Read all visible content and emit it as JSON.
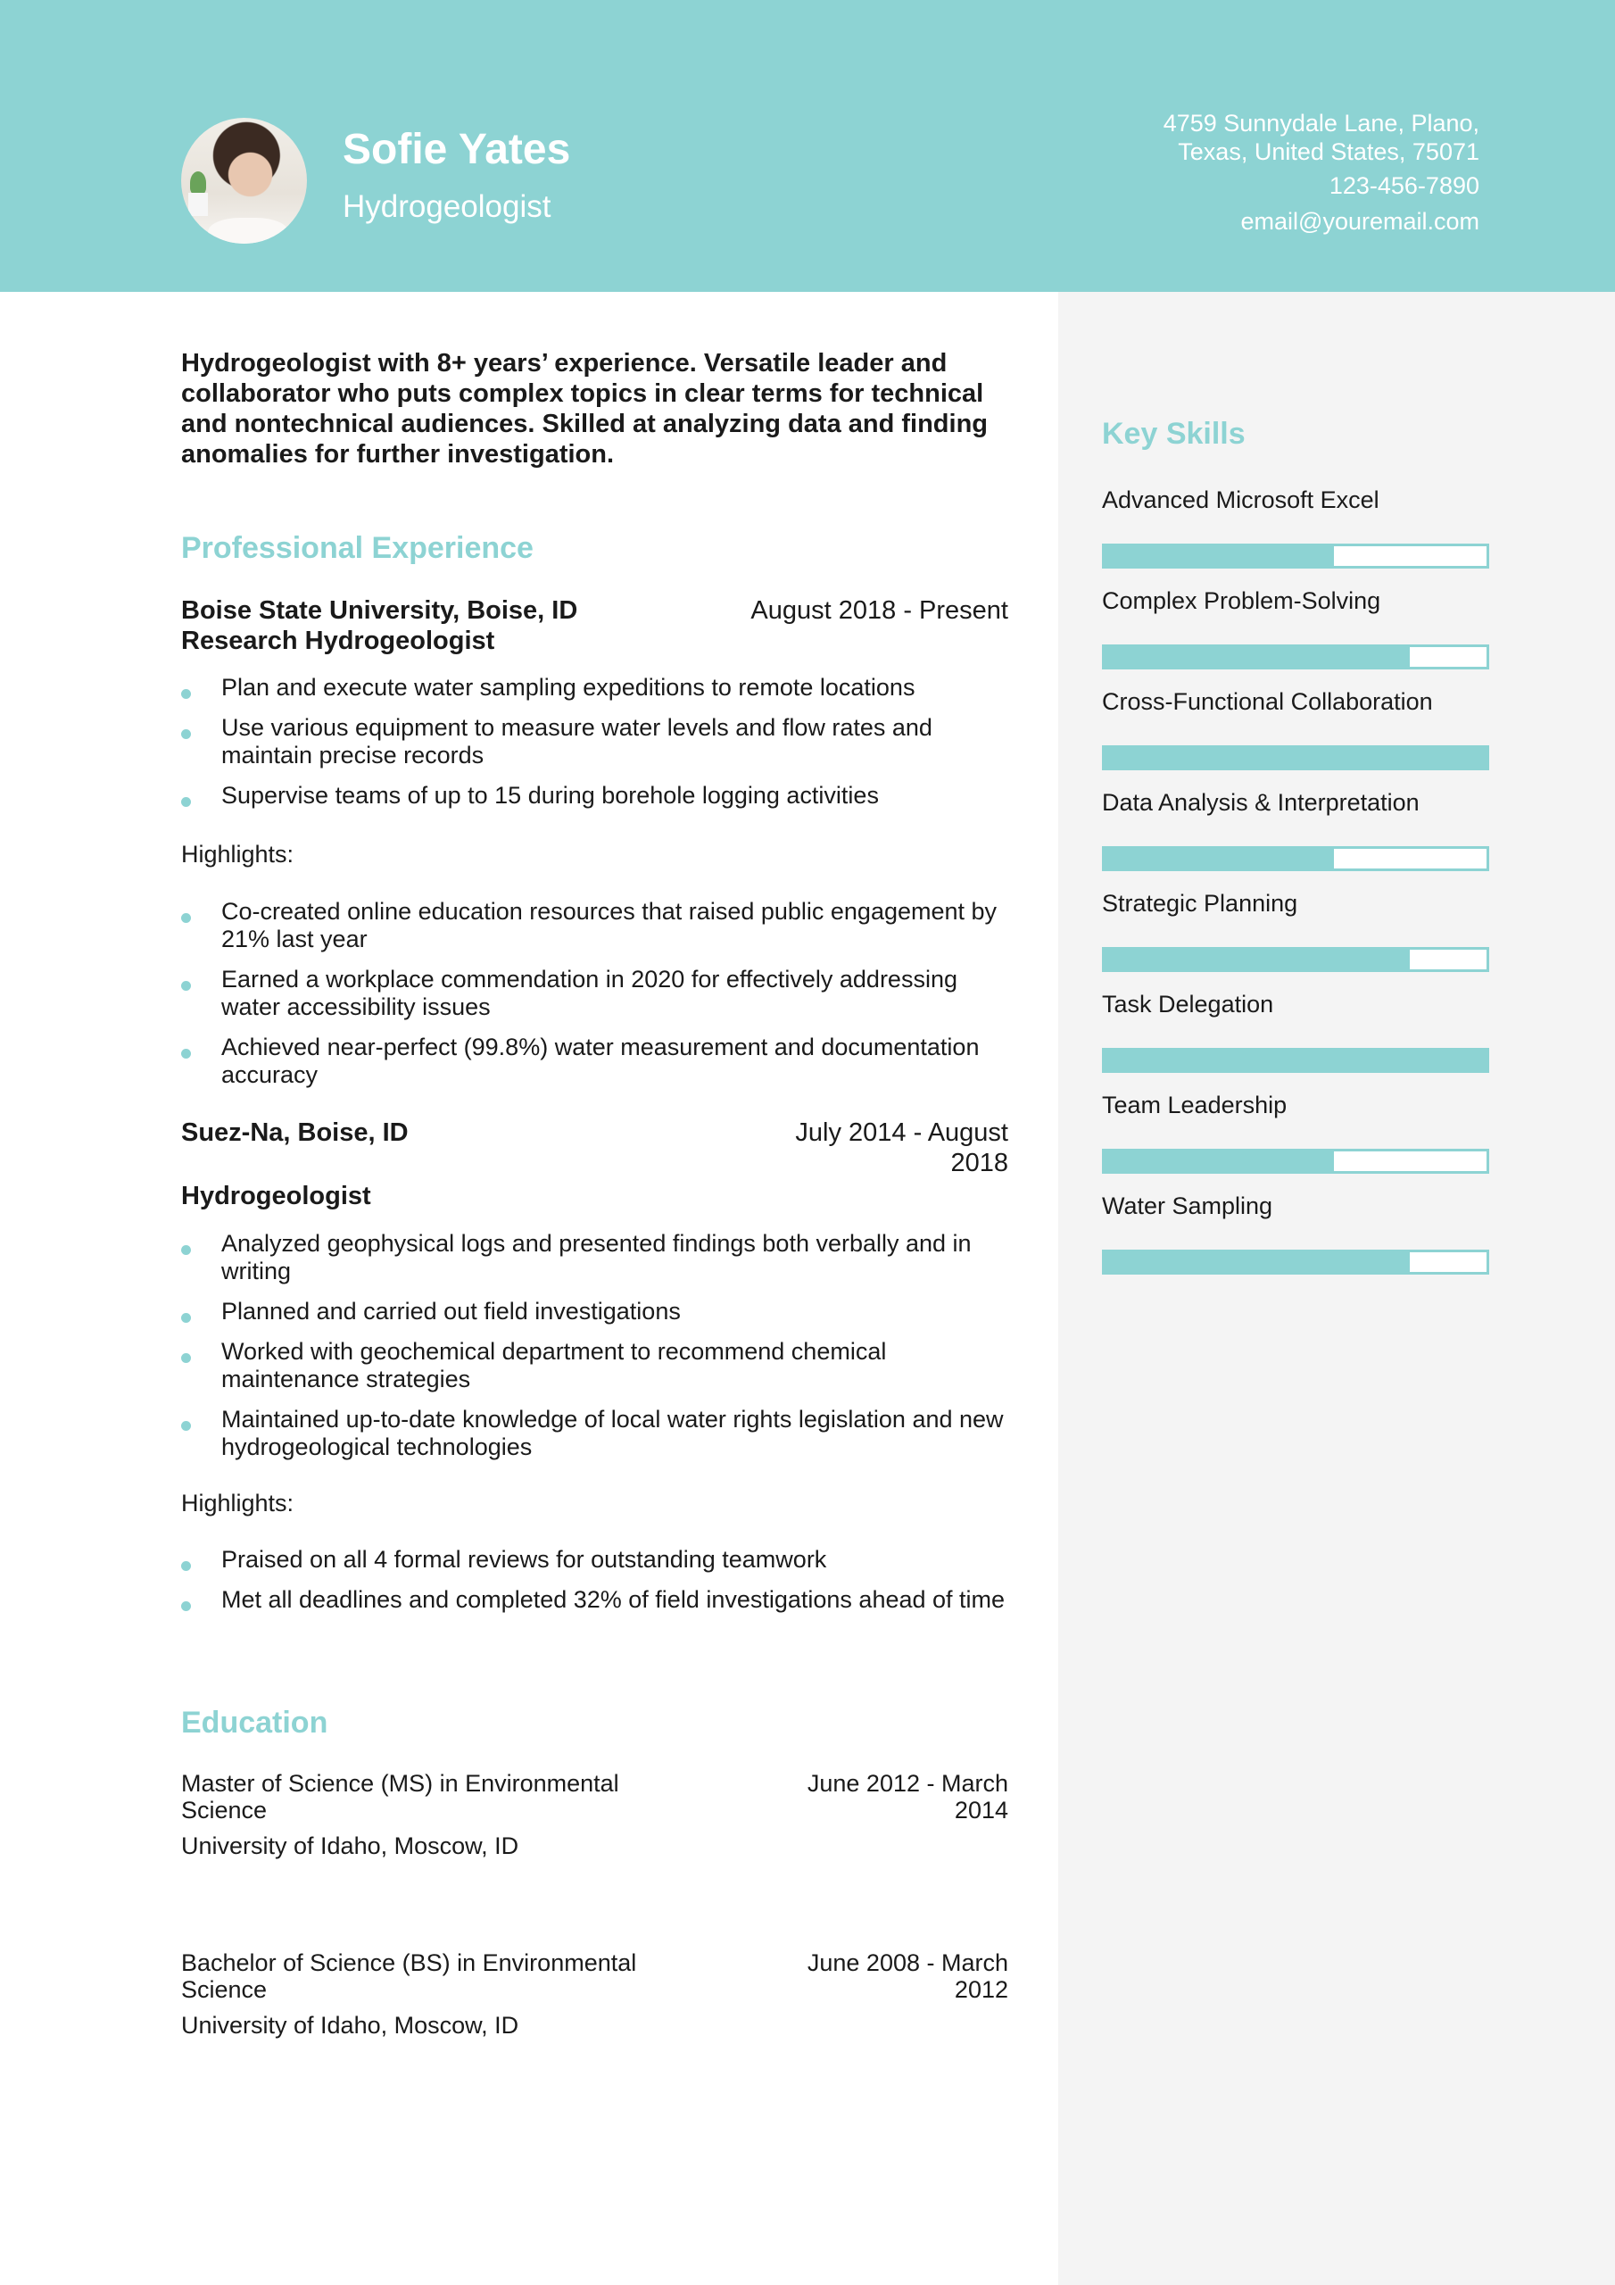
{
  "header": {
    "name": "Sofie Yates",
    "title": "Hydrogeologist",
    "address_line1": "4759 Sunnydale Lane, Plano,",
    "address_line2": "Texas, United States, 75071",
    "phone": "123-456-7890",
    "email": "email@youremail.com"
  },
  "colors": {
    "accent": "#8dd3d3",
    "sidebar_bg": "#f4f4f4",
    "text": "#1a1a1a"
  },
  "summary": "Hydrogeologist with 8+ years’ experience. Versatile leader and collaborator who puts complex topics in clear terms for technical and nontechnical audiences. Skilled at analyzing data and finding anomalies for further investigation.",
  "experience": {
    "heading": "Professional Experience",
    "jobs": [
      {
        "company": "Boise State University, Boise, ID",
        "dates": "August 2018 - Present",
        "role": "Research Hydrogeologist",
        "bullets": [
          "Plan and execute water sampling expeditions to remote locations",
          "Use various equipment to measure water levels and flow rates and maintain precise records",
          "Supervise teams of up to 15 during borehole logging activities"
        ],
        "highlights_label": "Highlights:",
        "highlights": [
          "Co-created online education resources that raised public engagement by 21% last year",
          "Earned a workplace commendation in 2020 for effectively addressing water accessibility issues",
          "Achieved near-perfect (99.8%) water measurement and documentation accuracy"
        ]
      },
      {
        "company": "Suez-Na, Boise, ID",
        "dates": "July 2014 - August 2018",
        "role": "Hydrogeologist",
        "bullets": [
          "Analyzed geophysical logs and presented findings both verbally and in writing",
          "Planned and carried out field investigations",
          "Worked with geochemical department to recommend chemical maintenance strategies",
          "Maintained up-to-date knowledge of local water rights legislation and new hydrogeological technologies"
        ],
        "highlights_label": "Highlights:",
        "highlights": [
          "Praised on all 4 formal reviews for outstanding teamwork",
          "Met all deadlines and completed 32% of field investigations ahead of time"
        ]
      }
    ]
  },
  "education": {
    "heading": "Education",
    "items": [
      {
        "degree": "Master of Science (MS) in Environmental Science",
        "dates": "June 2012 - March 2014",
        "school": "University of Idaho, Moscow, ID"
      },
      {
        "degree": "Bachelor of Science (BS) in Environmental Science",
        "dates": "June 2008 - March 2012",
        "school": "University of Idaho, Moscow, ID"
      }
    ]
  },
  "skills": {
    "heading": "Key Skills",
    "items": [
      {
        "label": "Advanced Microsoft Excel",
        "level": 0.6
      },
      {
        "label": "Complex Problem-Solving",
        "level": 0.8
      },
      {
        "label": "Cross-Functional Collaboration",
        "level": 1.0
      },
      {
        "label": "Data Analysis & Interpretation",
        "level": 0.6
      },
      {
        "label": "Strategic Planning",
        "level": 0.8
      },
      {
        "label": "Task Delegation",
        "level": 1.0
      },
      {
        "label": "Team Leadership",
        "level": 0.6
      },
      {
        "label": "Water Sampling",
        "level": 0.8
      }
    ]
  }
}
